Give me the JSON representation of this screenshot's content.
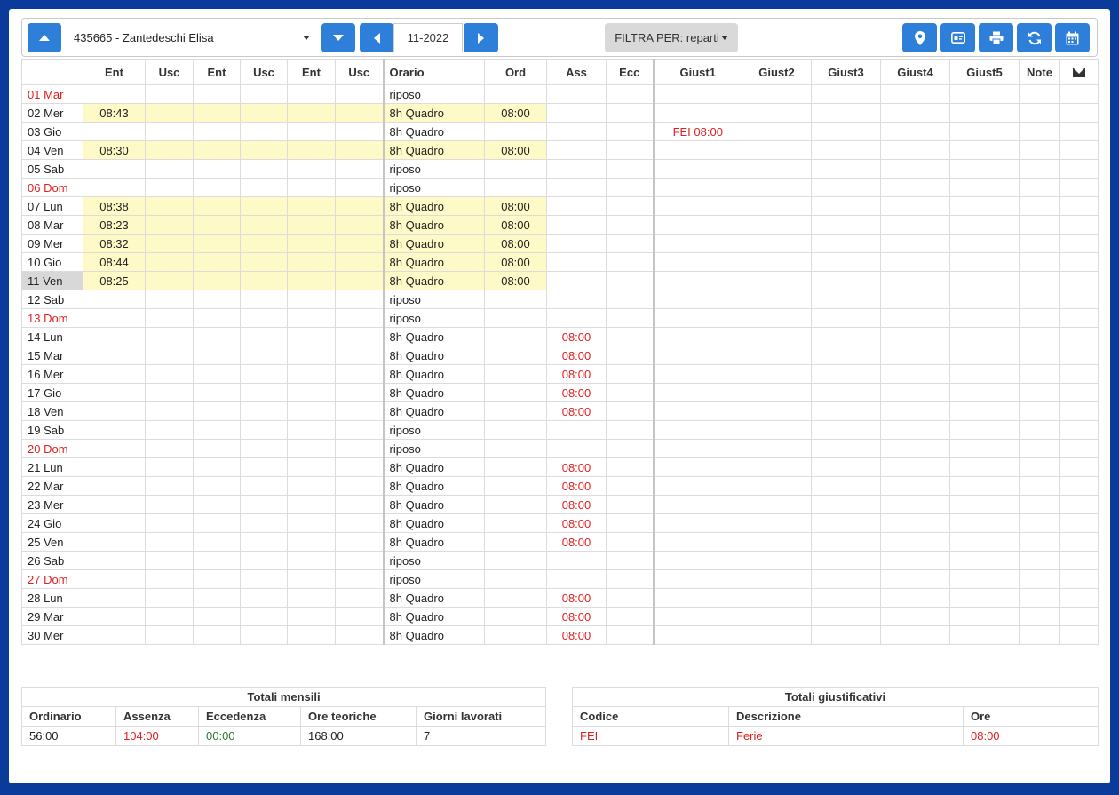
{
  "toolbar": {
    "employee": "435665 - Zantedeschi Elisa",
    "month": "11-2022",
    "filter_label": "FILTRA PER: reparti",
    "right_icons": [
      "map-pin-icon",
      "id-card-icon",
      "printer-icon",
      "refresh-icon",
      "calendar-icon"
    ]
  },
  "columns": [
    "",
    "Ent",
    "Usc",
    "Ent",
    "Usc",
    "Ent",
    "Usc",
    "Orario",
    "Ord",
    "Ass",
    "Ecc",
    "Giust1",
    "Giust2",
    "Giust3",
    "Giust4",
    "Giust5",
    "Note"
  ],
  "rows": [
    {
      "day": "01 Mar",
      "holiday": true,
      "ent": "",
      "orario": "riposo",
      "ord": "",
      "ass": "",
      "g1": ""
    },
    {
      "day": "02 Mer",
      "holiday": false,
      "ent": "08:43",
      "orario": "8h Quadro",
      "ord": "08:00",
      "ass": "",
      "g1": ""
    },
    {
      "day": "03 Gio",
      "holiday": false,
      "ent": "",
      "orario": "8h Quadro",
      "ord": "",
      "ass": "",
      "g1": "FEI 08:00"
    },
    {
      "day": "04 Ven",
      "holiday": false,
      "ent": "08:30",
      "orario": "8h Quadro",
      "ord": "08:00",
      "ass": "",
      "g1": ""
    },
    {
      "day": "05 Sab",
      "holiday": false,
      "ent": "",
      "orario": "riposo",
      "ord": "",
      "ass": "",
      "g1": ""
    },
    {
      "day": "06 Dom",
      "holiday": true,
      "ent": "",
      "orario": "riposo",
      "ord": "",
      "ass": "",
      "g1": ""
    },
    {
      "day": "07 Lun",
      "holiday": false,
      "ent": "08:38",
      "orario": "8h Quadro",
      "ord": "08:00",
      "ass": "",
      "g1": ""
    },
    {
      "day": "08 Mar",
      "holiday": false,
      "ent": "08:23",
      "orario": "8h Quadro",
      "ord": "08:00",
      "ass": "",
      "g1": ""
    },
    {
      "day": "09 Mer",
      "holiday": false,
      "ent": "08:32",
      "orario": "8h Quadro",
      "ord": "08:00",
      "ass": "",
      "g1": ""
    },
    {
      "day": "10 Gio",
      "holiday": false,
      "ent": "08:44",
      "orario": "8h Quadro",
      "ord": "08:00",
      "ass": "",
      "g1": ""
    },
    {
      "day": "11 Ven",
      "holiday": false,
      "ent": "08:25",
      "orario": "8h Quadro",
      "ord": "08:00",
      "ass": "",
      "g1": "",
      "selected": true
    },
    {
      "day": "12 Sab",
      "holiday": false,
      "ent": "",
      "orario": "riposo",
      "ord": "",
      "ass": "",
      "g1": ""
    },
    {
      "day": "13 Dom",
      "holiday": true,
      "ent": "",
      "orario": "riposo",
      "ord": "",
      "ass": "",
      "g1": ""
    },
    {
      "day": "14 Lun",
      "holiday": false,
      "ent": "",
      "orario": "8h Quadro",
      "ord": "",
      "ass": "08:00",
      "g1": ""
    },
    {
      "day": "15 Mar",
      "holiday": false,
      "ent": "",
      "orario": "8h Quadro",
      "ord": "",
      "ass": "08:00",
      "g1": ""
    },
    {
      "day": "16 Mer",
      "holiday": false,
      "ent": "",
      "orario": "8h Quadro",
      "ord": "",
      "ass": "08:00",
      "g1": ""
    },
    {
      "day": "17 Gio",
      "holiday": false,
      "ent": "",
      "orario": "8h Quadro",
      "ord": "",
      "ass": "08:00",
      "g1": ""
    },
    {
      "day": "18 Ven",
      "holiday": false,
      "ent": "",
      "orario": "8h Quadro",
      "ord": "",
      "ass": "08:00",
      "g1": ""
    },
    {
      "day": "19 Sab",
      "holiday": false,
      "ent": "",
      "orario": "riposo",
      "ord": "",
      "ass": "",
      "g1": ""
    },
    {
      "day": "20 Dom",
      "holiday": true,
      "ent": "",
      "orario": "riposo",
      "ord": "",
      "ass": "",
      "g1": ""
    },
    {
      "day": "21 Lun",
      "holiday": false,
      "ent": "",
      "orario": "8h Quadro",
      "ord": "",
      "ass": "08:00",
      "g1": ""
    },
    {
      "day": "22 Mar",
      "holiday": false,
      "ent": "",
      "orario": "8h Quadro",
      "ord": "",
      "ass": "08:00",
      "g1": ""
    },
    {
      "day": "23 Mer",
      "holiday": false,
      "ent": "",
      "orario": "8h Quadro",
      "ord": "",
      "ass": "08:00",
      "g1": ""
    },
    {
      "day": "24 Gio",
      "holiday": false,
      "ent": "",
      "orario": "8h Quadro",
      "ord": "",
      "ass": "08:00",
      "g1": ""
    },
    {
      "day": "25 Ven",
      "holiday": false,
      "ent": "",
      "orario": "8h Quadro",
      "ord": "",
      "ass": "08:00",
      "g1": ""
    },
    {
      "day": "26 Sab",
      "holiday": false,
      "ent": "",
      "orario": "riposo",
      "ord": "",
      "ass": "",
      "g1": ""
    },
    {
      "day": "27 Dom",
      "holiday": true,
      "ent": "",
      "orario": "riposo",
      "ord": "",
      "ass": "",
      "g1": ""
    },
    {
      "day": "28 Lun",
      "holiday": false,
      "ent": "",
      "orario": "8h Quadro",
      "ord": "",
      "ass": "08:00",
      "g1": ""
    },
    {
      "day": "29 Mar",
      "holiday": false,
      "ent": "",
      "orario": "8h Quadro",
      "ord": "",
      "ass": "08:00",
      "g1": ""
    },
    {
      "day": "30 Mer",
      "holiday": false,
      "ent": "",
      "orario": "8h Quadro",
      "ord": "",
      "ass": "08:00",
      "g1": ""
    }
  ],
  "totals": {
    "title": "Totali mensili",
    "headers": [
      "Ordinario",
      "Assenza",
      "Eccedenza",
      "Ore teoriche",
      "Giorni lavorati"
    ],
    "values": [
      "56:00",
      "104:00",
      "00:00",
      "168:00",
      "7"
    ]
  },
  "justifications": {
    "title": "Totali giustificativi",
    "headers": [
      "Codice",
      "Descrizione",
      "Ore"
    ],
    "rows": [
      [
        "FEI",
        "Ferie",
        "08:00"
      ]
    ]
  },
  "colors": {
    "accent": "#2d7fd9",
    "holiday": "#e02020",
    "highlight": "#fdfac7",
    "background": "#0a3a9a"
  }
}
